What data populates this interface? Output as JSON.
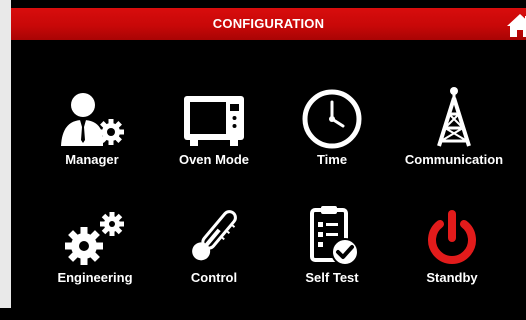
{
  "header": {
    "title": "CONFIGURATION",
    "home_icon": "home-icon"
  },
  "colors": {
    "header_red": "#c80808",
    "standby_red": "#e21b1b",
    "icon": "#ffffff",
    "background": "#000000"
  },
  "tiles": [
    {
      "label": "Manager",
      "icon": "manager-gear-icon"
    },
    {
      "label": "Oven Mode",
      "icon": "oven-icon"
    },
    {
      "label": "Time",
      "icon": "clock-icon"
    },
    {
      "label": "Communication",
      "icon": "antenna-tower-icon"
    },
    {
      "label": "Engineering",
      "icon": "gears-icon"
    },
    {
      "label": "Control",
      "icon": "thermometer-icon"
    },
    {
      "label": "Self Test",
      "icon": "clipboard-check-icon"
    },
    {
      "label": "Standby",
      "icon": "power-icon"
    }
  ]
}
